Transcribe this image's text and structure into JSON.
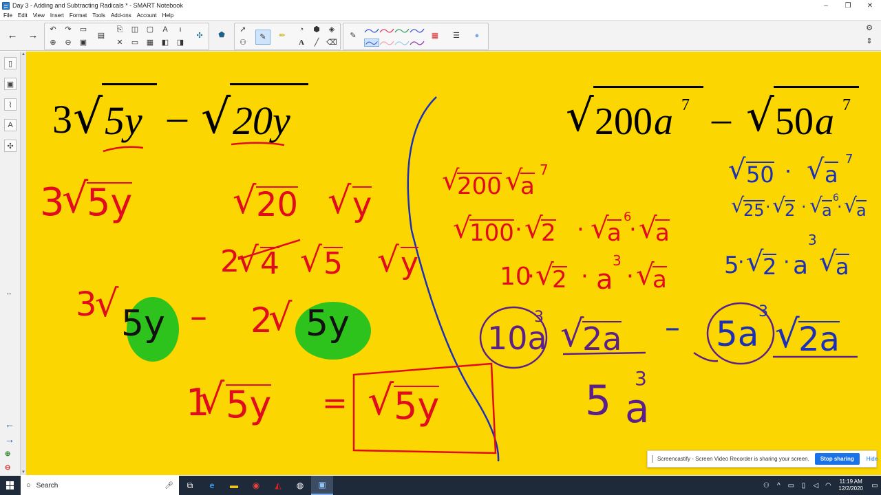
{
  "window": {
    "title": "Day 3 - Adding and Subtracting Radicals * - SMART Notebook",
    "controls": [
      "–",
      "❐",
      "✕"
    ]
  },
  "menu": [
    "File",
    "Edit",
    "View",
    "Insert",
    "Format",
    "Tools",
    "Add-ons",
    "Account",
    "Help"
  ],
  "toolbar": {
    "text_tool_label": "A",
    "colors": {
      "pens": [
        "#2b4fd6",
        "#5a8f2a",
        "#d9365e",
        "#2f9a58",
        "#3b4cc9",
        "#63aa3c",
        "#f2a0b0",
        "#9ec8f2",
        "#8c2fb0"
      ]
    }
  },
  "canvas": {
    "background": "#fcd600",
    "left_problem": {
      "coefficient": "3",
      "radicand_1": "5y",
      "minus": "–",
      "radicand_2": "20y"
    },
    "right_problem": {
      "radicand_1_num": "200",
      "radicand_1_var": "a",
      "exp_1": "7",
      "minus": "–",
      "radicand_2_num": "50",
      "radicand_2_var": "a",
      "exp_2": "7"
    },
    "ink_left": {
      "l1a_coef": "3",
      "l1a_rad": "5y",
      "l1b_rad1": "20",
      "l1b_rad2": "y",
      "l2_coef": "2",
      "l2_rad1": "4",
      "l2_rad2": "5",
      "l2_rad3": "y",
      "l3_coef1": "3",
      "l3_rad1": "5y",
      "l3_minus": "–",
      "l3_coef2": "2",
      "l3_rad2": "5y",
      "l4_coef": "1",
      "l4_rad": "5y",
      "l4_eq": "=",
      "l4_answer_rad": "5y"
    },
    "ink_middle": {
      "m1_rad1": "200",
      "m1_rad2": "a",
      "m1_exp": "7",
      "m2_rad1": "100",
      "m2_dot1": "·",
      "m2_rad2": "2",
      "m2_dot2": "·",
      "m2_rad3": "a",
      "m2_exp": "6",
      "m2_dot3": "·",
      "m2_rad4": "a",
      "m3_coef": "10",
      "m3_dot1": "·",
      "m3_rad1": "2",
      "m3_dot2": "·",
      "m3_var": "a",
      "m3_exp": "3",
      "m3_dot3": "·",
      "m3_rad2": "a",
      "m4_circle": "10a",
      "m4_exp": "3",
      "m4_rad": "2a"
    },
    "ink_right": {
      "r1_rad1": "50",
      "r1_dot": "·",
      "r1_rad2": "a",
      "r1_exp": "7",
      "r2_rad1": "25",
      "r2_dot1": "·",
      "r2_rad2": "2",
      "r2_dot2": "·",
      "r2_rad3": "a",
      "r2_exp": "6",
      "r2_dot3": "·",
      "r2_rad4": "a",
      "r3_coef": "5",
      "r3_dot1": "·",
      "r3_rad1": "2",
      "r3_dot2": "·",
      "r3_var": "a",
      "r3_exp": "3",
      "r3_rad2": "a",
      "r4_minus": "–",
      "r4_circle": "5a",
      "r4_exp": "3",
      "r4_rad": "2a",
      "r5_coef": "5",
      "r5_var": "a",
      "r5_exp": "3"
    }
  },
  "notification": {
    "message": "Screencastify - Screen Video Recorder is sharing your screen.",
    "stop_label": "Stop sharing",
    "hide_label": "Hide"
  },
  "taskbar": {
    "search_placeholder": "Search",
    "time": "11:19 AM",
    "date": "12/2/2020"
  }
}
